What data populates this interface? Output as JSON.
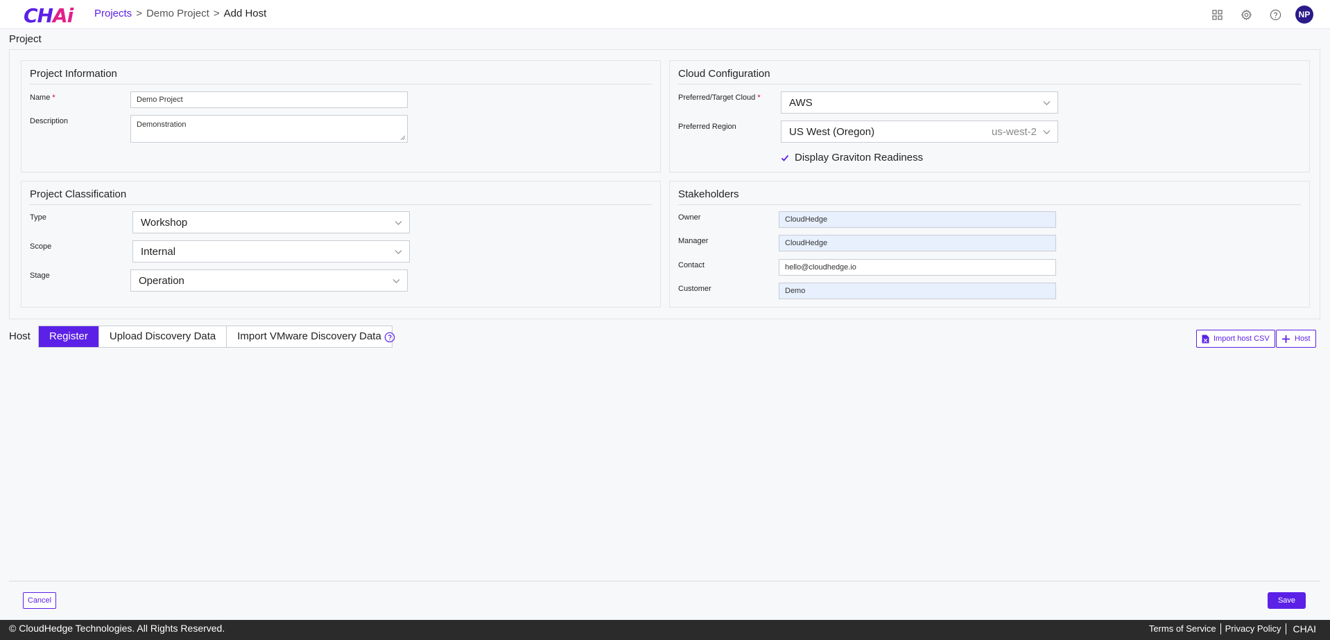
{
  "app": {
    "logo_main": "CH",
    "logo_accent": "Ai"
  },
  "breadcrumb": {
    "root": "Projects",
    "sep1": ">",
    "project": "Demo Project",
    "sep2": ">",
    "current": "Add Host"
  },
  "header": {
    "user_initials": "NP"
  },
  "page_title": "Project",
  "project_info": {
    "title": "Project Information",
    "name_label": "Name",
    "required_mark": "*",
    "name_value": "Demo Project",
    "description_label": "Description",
    "description_value": "Demonstration"
  },
  "cloud_config": {
    "title": "Cloud Configuration",
    "cloud_label": "Preferred/Target Cloud",
    "required_mark": "*",
    "cloud_value": "AWS",
    "region_label": "Preferred Region",
    "region_value": "US West (Oregon)",
    "region_code": "us-west-2",
    "graviton_label": "Display Graviton Readiness"
  },
  "classification": {
    "title": "Project Classification",
    "type_label": "Type",
    "type_value": "Workshop",
    "scope_label": "Scope",
    "scope_value": "Internal",
    "stage_label": "Stage",
    "stage_value": "Operation"
  },
  "stakeholders": {
    "title": "Stakeholders",
    "owner_label": "Owner",
    "owner_value": "CloudHedge",
    "manager_label": "Manager",
    "manager_value": "CloudHedge",
    "contact_label": "Contact",
    "contact_value": "hello@cloudhedge.io",
    "customer_label": "Customer",
    "customer_value": "Demo"
  },
  "host": {
    "label": "Host",
    "tabs": [
      {
        "label": "Register"
      },
      {
        "label": "Upload Discovery Data"
      },
      {
        "label": "Import VMware Discovery Data"
      }
    ],
    "import_csv_label": "Import host CSV",
    "add_host_label": "Host"
  },
  "footer": {
    "cancel_label": "Cancel",
    "save_label": "Save",
    "copyright": "© CloudHedge Technologies. All Rights Reserved.",
    "terms": "Terms of Service",
    "privacy": "Privacy Policy",
    "brand": "CHAI"
  },
  "colors": {
    "accent": "#5b21e6",
    "logo_accent": "#e0218a",
    "autofill": "#e8f0fe",
    "footer_bg": "#2b2b2b"
  }
}
